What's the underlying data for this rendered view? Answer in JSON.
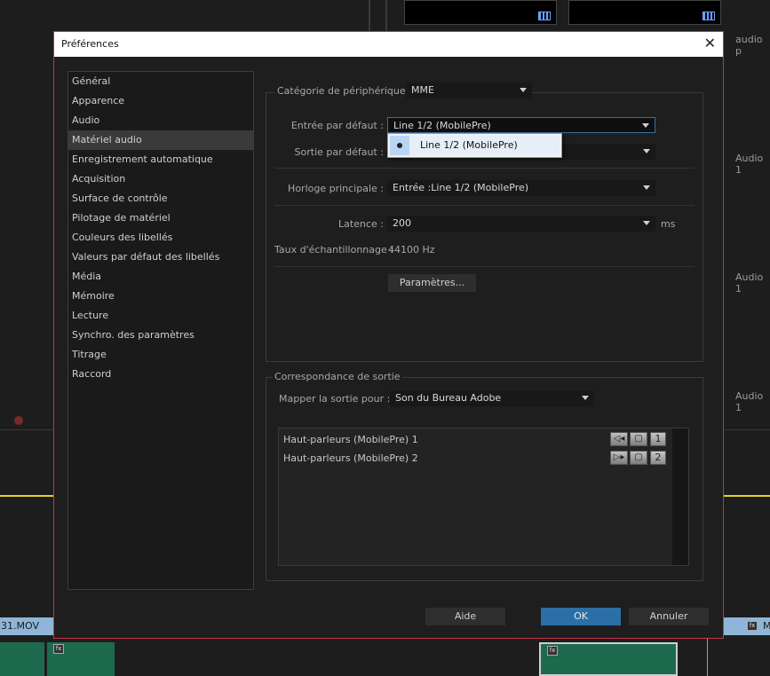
{
  "background": {
    "track_labels": [
      "audio p",
      "Audio 1",
      "Audio 1",
      "Audio 1"
    ],
    "clip_label": "31.MOV",
    "right_clip_label": "M",
    "fx_label": "fx"
  },
  "dialog": {
    "title": "Préférences",
    "close_glyph": "✕",
    "sidebar": {
      "items": [
        {
          "label": "Général"
        },
        {
          "label": "Apparence"
        },
        {
          "label": "Audio"
        },
        {
          "label": "Matériel audio",
          "active": true
        },
        {
          "label": "Enregistrement automatique"
        },
        {
          "label": "Acquisition"
        },
        {
          "label": "Surface de contrôle"
        },
        {
          "label": "Pilotage de matériel"
        },
        {
          "label": "Couleurs des libellés"
        },
        {
          "label": "Valeurs par défaut des libellés"
        },
        {
          "label": "Média"
        },
        {
          "label": "Mémoire"
        },
        {
          "label": "Lecture"
        },
        {
          "label": "Synchro. des paramètres"
        },
        {
          "label": "Titrage"
        },
        {
          "label": "Raccord"
        }
      ]
    },
    "device": {
      "category_label": "Catégorie de périphérique :",
      "category_value": "MME",
      "input_label": "Entrée par défaut :",
      "input_value": "Line 1/2 (MobilePre)",
      "output_label": "Sortie par défaut :",
      "master_clock_label": "Horloge principale :",
      "master_clock_value": "Entrée :Line 1/2 (MobilePre)",
      "latency_label": "Latence :",
      "latency_value": "200",
      "latency_unit": "ms",
      "sample_rate_label": "Taux d'échantillonnage :",
      "sample_rate_value": "44100 Hz",
      "settings_button": "Paramètres..."
    },
    "input_popup": {
      "items": [
        "Line 1/2 (MobilePre)"
      ]
    },
    "output_mapping": {
      "group_label": "Correspondance de sortie",
      "map_label": "Mapper la sortie pour :",
      "map_value": "Son du Bureau Adobe",
      "outputs": [
        {
          "label": "Haut-parleurs (MobilePre) 1",
          "channel": "1"
        },
        {
          "label": "Haut-parleurs (MobilePre) 2",
          "channel": "2"
        }
      ]
    },
    "buttons": {
      "help": "Aide",
      "ok": "OK",
      "cancel": "Annuler"
    },
    "colors": {
      "accent_ok": "#2a6fa6",
      "dialog_border": "#c8324a",
      "active_item": "#3a3a3a"
    }
  }
}
